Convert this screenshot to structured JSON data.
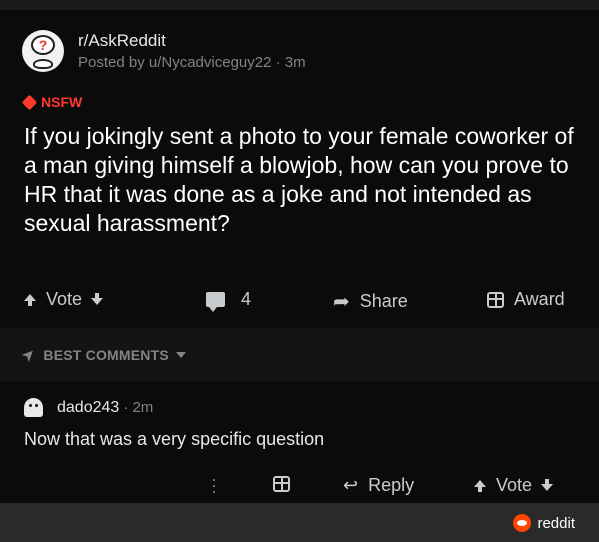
{
  "post": {
    "subreddit": "r/AskReddit",
    "posted_by": "Posted by u/Nycadviceguy22 · 3m",
    "nsfw_label": "NSFW",
    "title": "If you jokingly sent a photo to your female coworker of a man giving himself a blowjob, how can you prove to HR that it was done as a joke and not intended as sexual harassment?"
  },
  "actions": {
    "vote_label": "Vote",
    "comment_count": "4",
    "share_label": "Share",
    "award_label": "Award"
  },
  "comments": {
    "sort_label": "BEST COMMENTS",
    "items": [
      {
        "username": "dado243",
        "time": "· 2m",
        "body": "Now that was a very specific question",
        "reply_label": "Reply",
        "vote_label": "Vote"
      }
    ]
  },
  "footer": {
    "brand": "reddit"
  },
  "colors": {
    "background": "#0b0b0c",
    "nsfw": "#ff3a2c",
    "brand": "#ff4500",
    "muted": "#818384"
  }
}
